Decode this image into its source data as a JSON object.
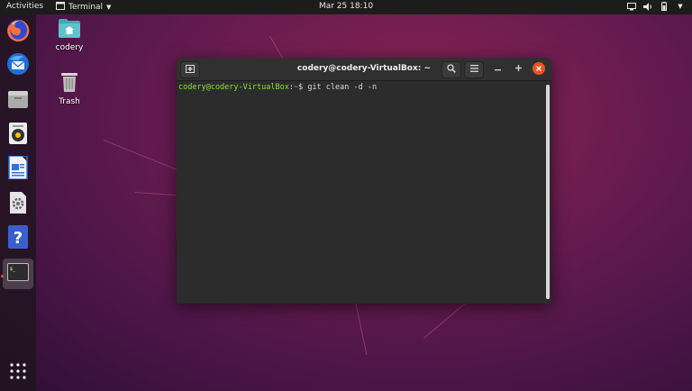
{
  "topbar": {
    "activities_label": "Activities",
    "app_menu_label": "Terminal",
    "clock": "Mar 25  18:10",
    "tray_icons": [
      "network-icon",
      "volume-icon",
      "battery-icon",
      "power-menu-icon"
    ]
  },
  "dock": {
    "items": [
      {
        "name": "firefox-icon"
      },
      {
        "name": "thunderbird-icon"
      },
      {
        "name": "files-icon"
      },
      {
        "name": "rhythmbox-icon"
      },
      {
        "name": "libreoffice-writer-icon"
      },
      {
        "name": "software-icon"
      },
      {
        "name": "help-icon"
      },
      {
        "name": "terminal-icon",
        "active": true
      }
    ],
    "show_apps_icon": "app-grid-icon"
  },
  "desktop": {
    "icons": [
      {
        "label": "codery",
        "icon": "home-folder-icon"
      },
      {
        "label": "Trash",
        "icon": "trash-icon"
      }
    ]
  },
  "terminal": {
    "title": "codery@codery-VirtualBox: ~",
    "prompt_user": "codery@codery-VirtualBox",
    "prompt_sep": ":",
    "prompt_path": "~",
    "prompt_symbol": "$",
    "command": " git clean -d -n"
  },
  "colors": {
    "accent": "#e95420",
    "prompt_user": "#8ae234",
    "prompt_path": "#729fcf"
  }
}
